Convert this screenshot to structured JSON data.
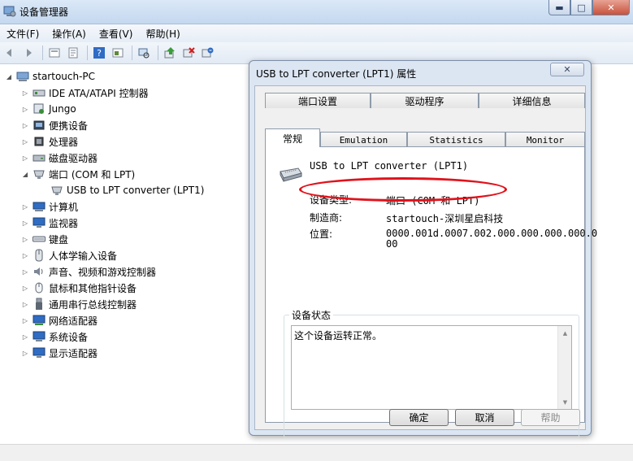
{
  "window": {
    "title": "设备管理器",
    "controls": {
      "minimize": "▬",
      "maximize": "□",
      "close": "✕"
    }
  },
  "menu": {
    "items": [
      "文件(F)",
      "操作(A)",
      "查看(V)",
      "帮助(H)"
    ]
  },
  "toolbar": {
    "buttons": [
      "back-icon",
      "forward-icon",
      "up-icon",
      "properties-icon",
      "help-icon",
      "show-hide-icon",
      "scan-icon",
      "update-driver-icon",
      "disable-icon",
      "uninstall-icon"
    ]
  },
  "tree": {
    "root": "startouch-PC",
    "items": [
      "IDE ATA/ATAPI 控制器",
      "Jungo",
      "便携设备",
      "处理器",
      "磁盘驱动器",
      "端口 (COM 和 LPT)",
      "USB to LPT converter (LPT1)",
      "计算机",
      "监视器",
      "键盘",
      "人体学输入设备",
      "声音、视频和游戏控制器",
      "鼠标和其他指针设备",
      "通用串行总线控制器",
      "网络适配器",
      "系统设备",
      "显示适配器"
    ]
  },
  "dialog": {
    "title": "USB to LPT converter (LPT1) 属性",
    "close": "✕",
    "tabs_back": [
      "端口设置",
      "驱动程序",
      "详细信息"
    ],
    "tabs_front": [
      "常规",
      "Emulation",
      "Statistics",
      "Monitor"
    ],
    "device_name": "USB to LPT converter (LPT1)",
    "fields": {
      "type_label": "设备类型:",
      "type_value": "端口 (COM 和 LPT)",
      "mfr_label": "制造商:",
      "mfr_value": "startouch-深圳星启科技",
      "loc_label": "位置:",
      "loc_value_1": "0000.001d.0007.002.000.000.000.000.0",
      "loc_value_2": "00"
    },
    "status": {
      "label": "设备状态",
      "text": "这个设备运转正常。"
    },
    "buttons": {
      "ok": "确定",
      "cancel": "取消",
      "help": "帮助"
    }
  },
  "colors": {
    "annotation": "#e0121b",
    "titlebar": "#c4d8ef",
    "dialog_frame": "#dce6f3"
  }
}
